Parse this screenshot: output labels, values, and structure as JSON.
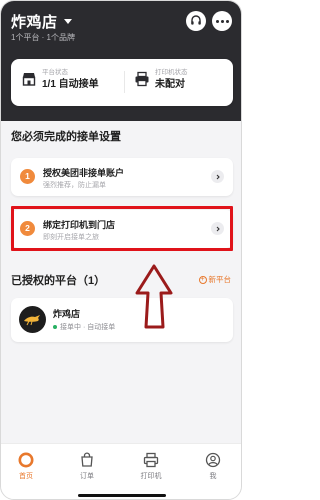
{
  "header": {
    "store_name": "炸鸡店",
    "store_sub": "1个平台 · 1个品牌"
  },
  "status": {
    "platform_label": "平台状态",
    "platform_value": "1/1 自动接单",
    "printer_label": "打印机状态",
    "printer_value": "未配对"
  },
  "setup": {
    "title": "您必须完成的接单设置",
    "tasks": [
      {
        "num": "1",
        "title": "授权美团非接单账户",
        "sub": "强烈推荐，防止漏单"
      },
      {
        "num": "2",
        "title": "绑定打印机到门店",
        "sub": "即刻开启接单之旅"
      }
    ]
  },
  "platforms": {
    "title": "已授权的平台（1）",
    "add_label": "新平台",
    "items": [
      {
        "name": "炸鸡店",
        "status": "接单中 · 自动接单"
      }
    ]
  },
  "nav": {
    "items": [
      {
        "label": "首页",
        "icon": "home-icon"
      },
      {
        "label": "订单",
        "icon": "orders-icon"
      },
      {
        "label": "打印机",
        "icon": "printer-icon"
      },
      {
        "label": "我",
        "icon": "profile-icon"
      }
    ]
  },
  "colors": {
    "header_bg": "#2b2b2f",
    "accent": "#e8782c",
    "highlight": "#e0131a",
    "status_green": "#27b062"
  }
}
